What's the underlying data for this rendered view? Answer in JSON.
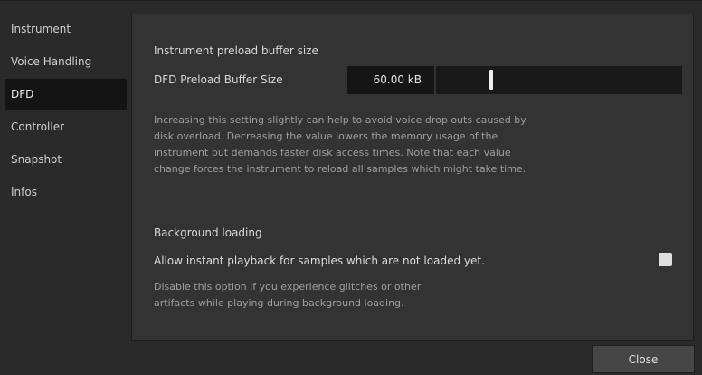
{
  "sidebar": {
    "items": [
      {
        "label": "Instrument"
      },
      {
        "label": "Voice Handling"
      },
      {
        "label": "DFD"
      },
      {
        "label": "Controller"
      },
      {
        "label": "Snapshot"
      },
      {
        "label": "Infos"
      }
    ],
    "active": "DFD"
  },
  "dfd": {
    "buffer_section_title": "Instrument preload buffer size",
    "buffer_label": "DFD Preload Buffer Size",
    "buffer_value": "60.00 kB",
    "buffer_slider_position": 0.22,
    "buffer_description": [
      "Increasing this setting slightly can help to avoid voice drop outs caused by",
      "disk overload. Decreasing the value lowers the memory usage of the",
      "instrument but demands faster disk access times. Note that each value",
      "change forces the instrument to reload all samples which might take time."
    ],
    "background_section_title": "Background loading",
    "allow_instant_label": "Allow instant playback for samples which are not loaded yet.",
    "allow_instant_checked": false,
    "background_description": [
      "Disable this option if you experience glitches or other",
      "artifacts while playing during background loading."
    ]
  },
  "footer": {
    "close_label": "Close"
  },
  "colors": {
    "window_bg": "#2a2a2a",
    "panel_bg": "#333333",
    "field_bg": "#151515",
    "active_tab_bg": "#141414",
    "text": "#d8d8d8",
    "muted_text": "#9f9f9f"
  }
}
